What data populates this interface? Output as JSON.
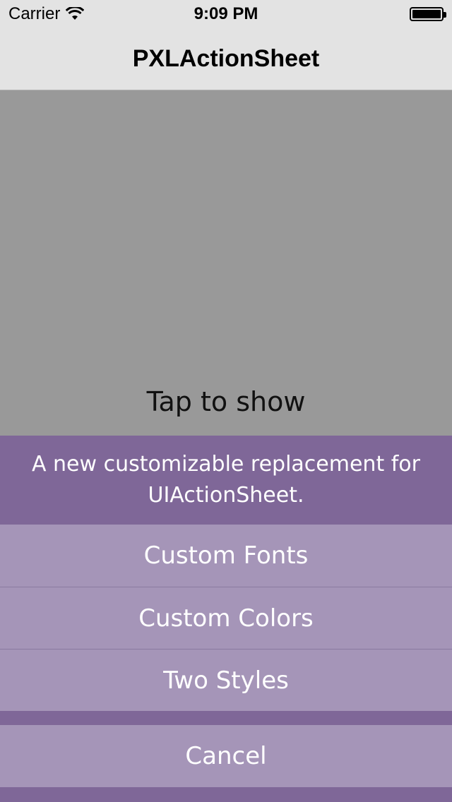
{
  "status_bar": {
    "carrier": "Carrier",
    "time": "9:09 PM",
    "wifi_icon": "wifi-icon",
    "battery_icon": "battery-icon",
    "battery_level": 1.0
  },
  "nav": {
    "title": "PXLActionSheet"
  },
  "content": {
    "tap_label": "Tap to show"
  },
  "action_sheet": {
    "title": "A new customizable replacement for UIActionSheet.",
    "buttons": [
      {
        "label": "Custom Fonts"
      },
      {
        "label": "Custom Colors"
      },
      {
        "label": "Two Styles"
      }
    ],
    "cancel_label": "Cancel"
  },
  "colors": {
    "background": "#999999",
    "bar": "#e3e3e3",
    "sheet_dark": "#7f6798",
    "sheet_button": "#a595b8",
    "sheet_text": "#ffffff"
  }
}
